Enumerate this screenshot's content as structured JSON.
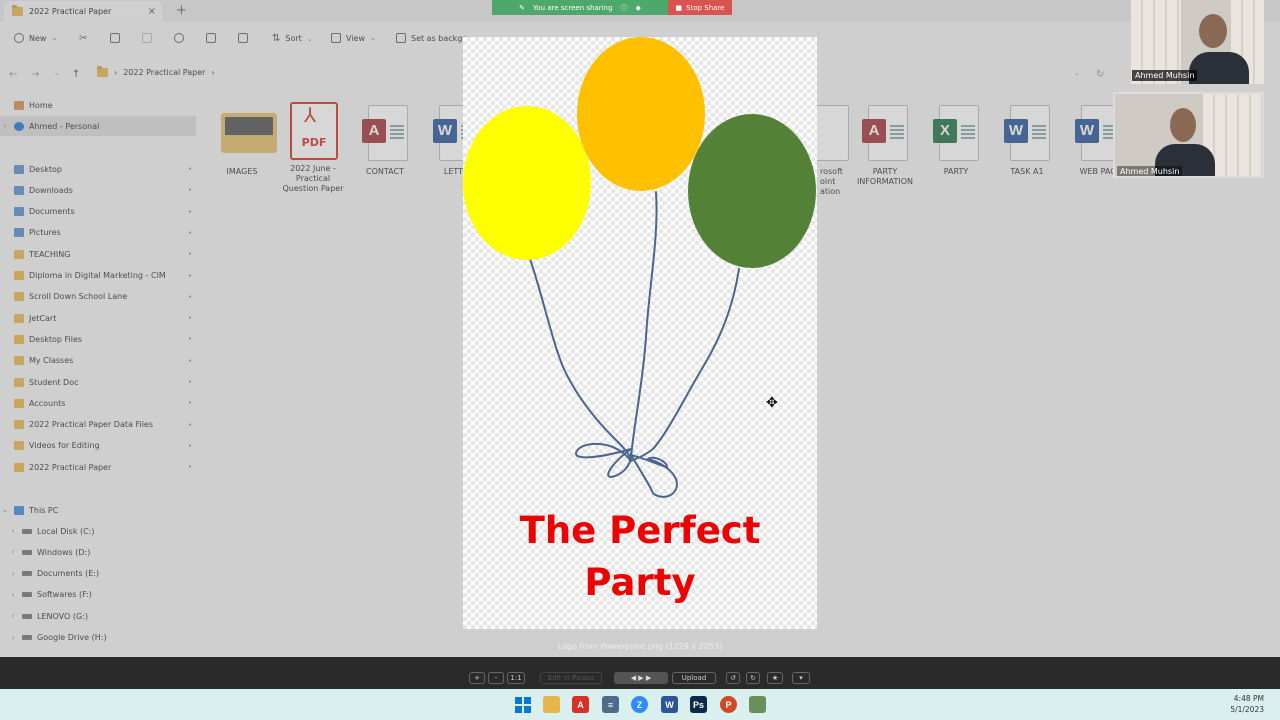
{
  "window": {
    "tab_title": "2022 Practical Paper",
    "close_glyph": "×",
    "add_tab_glyph": "+"
  },
  "toolbar": {
    "new_label": "New",
    "sort_label": "Sort",
    "view_label": "View",
    "set_background_label": "Set as backgr"
  },
  "address": {
    "crumb": "2022 Practical Paper",
    "sep": "›"
  },
  "sidebar": {
    "home": "Home",
    "personal": "Ahmed - Personal",
    "quick_access": [
      "Desktop",
      "Downloads",
      "Documents",
      "Pictures",
      "TEACHING",
      "Diploma in Digital Marketing - CIM",
      "Scroll Down School Lane",
      "JetCart",
      "Desktop Files",
      "My Classes",
      "Student Doc",
      "Accounts",
      "2022 Practical Paper Data Files",
      "Videos for Editing",
      "2022 Practical Paper"
    ],
    "this_pc": "This PC",
    "drives": [
      "Local Disk (C:)",
      "Windows (D:)",
      "Documents (E:)",
      "Softwares (F:)",
      "LENOVO (G:)",
      "Google Drive (H:)"
    ]
  },
  "files": {
    "images": "IMAGES",
    "pdf_name": "2022 June - Practical Question Paper",
    "pdf_badge": "PDF",
    "contact": "CONTACT",
    "letter": "LETTE",
    "ppt_partial": "rosoft\noint\nation",
    "party_info": "PARTY INFORMATION",
    "party": "PARTY",
    "task": "TASK A1",
    "web": "WEB PAG"
  },
  "share": {
    "status": "You are screen sharing",
    "stop": "Stop Share"
  },
  "video": {
    "name_top": "Ahmed Muhsin",
    "name_second": "Ahmed Muhsin"
  },
  "viewer": {
    "caption": "Logo from Powerpoint.png (1229 x 2053)",
    "buttons": {
      "plus": "+",
      "minus": "-",
      "one_to_one": "1:1",
      "edit": "Edit in Picasa",
      "upload": "Upload"
    },
    "poster_title": "The Perfect\nParty"
  },
  "balloons": {
    "yellow": "#ffff00",
    "orange": "#ffc000",
    "green": "#538135",
    "string": "#4a6590"
  },
  "taskbar": {
    "time": "4:48 PM",
    "date": "5/1/2023"
  },
  "colors": {
    "access": "#a4373a",
    "word": "#2b579a",
    "excel": "#217346",
    "pdf": "#d93025"
  }
}
